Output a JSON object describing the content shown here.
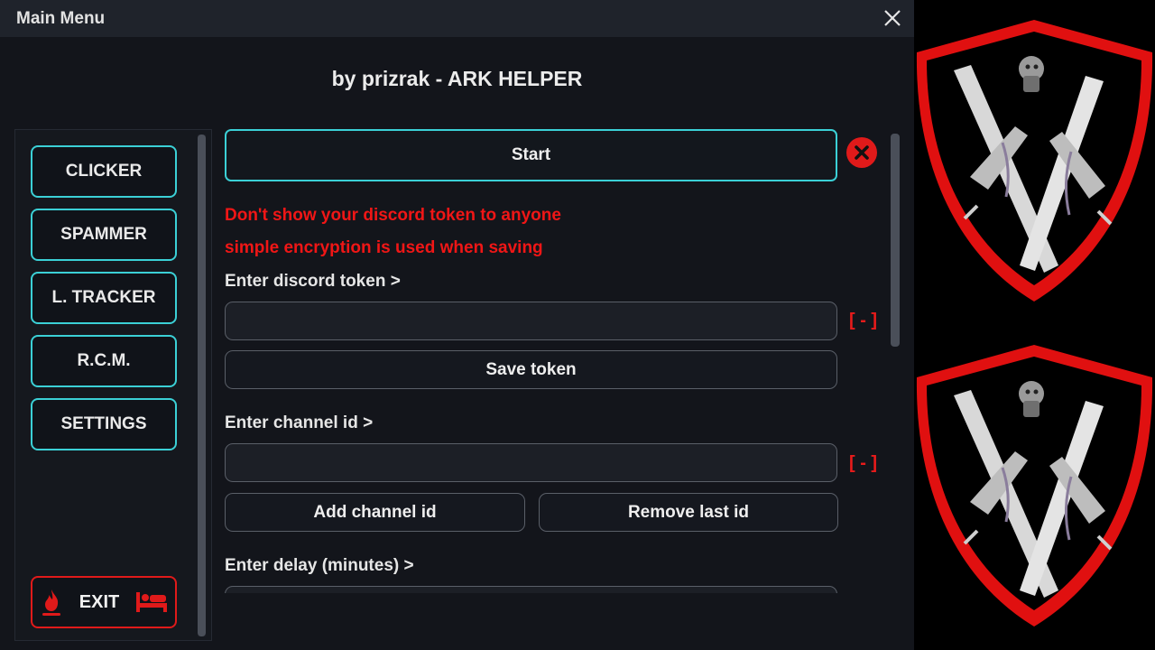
{
  "window": {
    "title": "Main Menu",
    "heading": "by prizrak - ARK HELPER"
  },
  "sidebar": {
    "items": [
      {
        "label": "CLICKER"
      },
      {
        "label": "SPAMMER"
      },
      {
        "label": "L. TRACKER"
      },
      {
        "label": "R.C.M."
      },
      {
        "label": "SETTINGS"
      }
    ],
    "exit_label": "EXIT"
  },
  "main": {
    "start_label": "Start",
    "warnings": [
      "Don't show your discord token to anyone",
      "simple encryption is used when saving"
    ],
    "token_label": "Enter discord token >",
    "token_value": "",
    "token_clear": "[ - ]",
    "save_token_label": "Save token",
    "channel_label": "Enter channel id >",
    "channel_value": "",
    "channel_clear": "[ - ]",
    "add_channel_label": "Add channel id",
    "remove_last_label": "Remove last id",
    "delay_label": "Enter delay (minutes) >",
    "delay_value": ""
  },
  "colors": {
    "accent": "#3bd0d6",
    "danger": "#e01a1a",
    "background": "#13151b"
  },
  "icons": {
    "close": "close-icon",
    "stop": "stop-circle-icon",
    "exit_left": "flame-icon",
    "exit_right": "bed-icon",
    "emblem": "shield-crossed-swords-emblem"
  }
}
